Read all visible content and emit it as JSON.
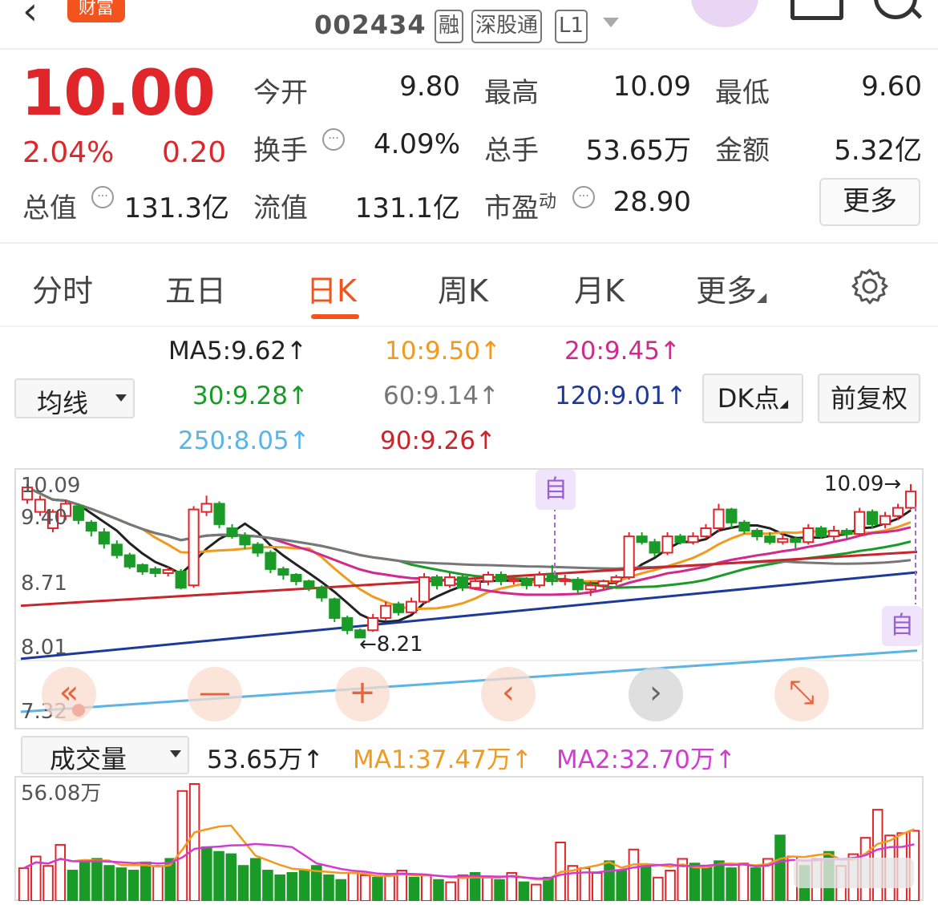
{
  "header": {
    "back_icon": "chevron-left-icon",
    "brand": "财富",
    "code": "002434",
    "tags": [
      "融",
      "深股通",
      "L1"
    ]
  },
  "quote": {
    "price": "10.00",
    "change_pct": "2.04%",
    "change": "0.20",
    "items": [
      {
        "label": "今开",
        "value": "9.80"
      },
      {
        "label": "最高",
        "value": "10.09"
      },
      {
        "label": "最低",
        "value": "9.60"
      },
      {
        "label": "换手",
        "value": "4.09%"
      },
      {
        "label": "总手",
        "value": "53.65万"
      },
      {
        "label": "金额",
        "value": "5.32亿"
      },
      {
        "label": "总值",
        "value": "131.3亿"
      },
      {
        "label": "流值",
        "value": "131.1亿"
      },
      {
        "label": "市盈",
        "sup": "动",
        "value": "28.90"
      }
    ],
    "more_button": "更多"
  },
  "tabs": [
    "分时",
    "五日",
    "日K",
    "周K",
    "月K",
    "更多"
  ],
  "active_tab": 2,
  "ma_selector": "均线",
  "ma_legend": [
    {
      "text": "MA5:9.62↑",
      "color": "#222222"
    },
    {
      "text": "10:9.50↑",
      "color": "#f29a1d"
    },
    {
      "text": "20:9.45↑",
      "color": "#d2298f"
    },
    {
      "text": "30:9.28↑",
      "color": "#1a9a26"
    },
    {
      "text": "60:9.14↑",
      "color": "#777777"
    },
    {
      "text": "120:9.01↑",
      "color": "#1d3a9a"
    },
    {
      "text": "250:8.05↑",
      "color": "#5ab4e6"
    },
    {
      "text": "90:9.26↑",
      "color": "#c8262d"
    }
  ],
  "dk_button": "DK点",
  "adjust_button": "前复权",
  "chart_labels": {
    "top": "10.09",
    "upper": "9.40",
    "mid": "8.71",
    "lower": "8.01",
    "bottom": "7.32",
    "high_marker": "10.09→",
    "low_marker": "←8.21",
    "zi": "自"
  },
  "chart_controls": [
    "«",
    "—",
    "+",
    "‹",
    "›",
    "⤡"
  ],
  "volume_selector": "成交量",
  "volume_legend": [
    {
      "text": "53.65万↑",
      "color": "#222222"
    },
    {
      "text": "MA1:37.47万↑",
      "color": "#f29a1d"
    },
    {
      "text": "MA2:32.70万↑",
      "color": "#d43ad1"
    }
  ],
  "volume_max_label": "56.08万",
  "chart_data": {
    "type": "candlestick",
    "ylim": [
      7.32,
      10.09
    ],
    "candles": [
      [
        9.9,
        10.05,
        10.09,
        9.85
      ],
      [
        9.75,
        9.9,
        9.95,
        9.7
      ],
      [
        9.55,
        9.75,
        9.78,
        9.5
      ],
      [
        9.7,
        9.85,
        9.9,
        9.65
      ],
      [
        9.82,
        9.65,
        9.85,
        9.6
      ],
      [
        9.62,
        9.52,
        9.65,
        9.45
      ],
      [
        9.5,
        9.36,
        9.55,
        9.3
      ],
      [
        9.35,
        9.22,
        9.4,
        9.18
      ],
      [
        9.22,
        9.08,
        9.25,
        9.05
      ],
      [
        9.1,
        9.02,
        9.12,
        8.98
      ],
      [
        9.05,
        9.0,
        9.08,
        8.95
      ],
      [
        9.0,
        9.04,
        9.08,
        8.96
      ],
      [
        9.02,
        8.82,
        9.05,
        8.8
      ],
      [
        8.85,
        9.78,
        9.82,
        8.82
      ],
      [
        9.75,
        9.85,
        9.95,
        9.7
      ],
      [
        9.85,
        9.6,
        9.88,
        9.55
      ],
      [
        9.55,
        9.45,
        9.6,
        9.42
      ],
      [
        9.45,
        9.35,
        9.5,
        9.3
      ],
      [
        9.35,
        9.25,
        9.38,
        9.2
      ],
      [
        9.25,
        9.05,
        9.28,
        9.0
      ],
      [
        9.05,
        8.98,
        9.08,
        8.92
      ],
      [
        8.98,
        8.9,
        9.0,
        8.85
      ],
      [
        8.9,
        8.82,
        8.92,
        8.78
      ],
      [
        8.82,
        8.7,
        8.85,
        8.65
      ],
      [
        8.68,
        8.45,
        8.7,
        8.4
      ],
      [
        8.45,
        8.3,
        8.48,
        8.25
      ],
      [
        8.3,
        8.21,
        8.32,
        8.21
      ],
      [
        8.3,
        8.45,
        8.5,
        8.28
      ],
      [
        8.45,
        8.6,
        8.65,
        8.42
      ],
      [
        8.62,
        8.52,
        8.65,
        8.48
      ],
      [
        8.52,
        8.65,
        8.7,
        8.5
      ],
      [
        8.65,
        8.95,
        9.0,
        8.62
      ],
      [
        8.95,
        8.85,
        8.98,
        8.8
      ],
      [
        8.85,
        8.95,
        9.0,
        8.82
      ],
      [
        8.95,
        8.82,
        8.98,
        8.78
      ],
      [
        8.82,
        8.9,
        8.95,
        8.8
      ],
      [
        8.9,
        8.98,
        9.02,
        8.85
      ],
      [
        8.98,
        8.9,
        9.02,
        8.85
      ],
      [
        8.9,
        8.92,
        8.98,
        8.86
      ],
      [
        8.92,
        8.85,
        8.95,
        8.8
      ],
      [
        8.85,
        8.98,
        9.02,
        8.82
      ],
      [
        8.98,
        8.9,
        9.1,
        8.85
      ],
      [
        8.9,
        8.92,
        8.98,
        8.85
      ],
      [
        8.92,
        8.8,
        8.95,
        8.75
      ],
      [
        8.8,
        8.85,
        8.9,
        8.72
      ],
      [
        8.85,
        8.9,
        8.92,
        8.8
      ],
      [
        8.9,
        8.95,
        8.98,
        8.85
      ],
      [
        8.95,
        9.45,
        9.5,
        8.92
      ],
      [
        9.45,
        9.38,
        9.5,
        9.35
      ],
      [
        9.38,
        9.25,
        9.42,
        9.2
      ],
      [
        9.25,
        9.45,
        9.5,
        9.22
      ],
      [
        9.45,
        9.38,
        9.48,
        9.35
      ],
      [
        9.38,
        9.45,
        9.5,
        9.35
      ],
      [
        9.45,
        9.55,
        9.6,
        9.42
      ],
      [
        9.55,
        9.78,
        9.85,
        9.5
      ],
      [
        9.78,
        9.62,
        9.8,
        9.55
      ],
      [
        9.62,
        9.52,
        9.65,
        9.48
      ],
      [
        9.52,
        9.45,
        9.55,
        9.4
      ],
      [
        9.45,
        9.38,
        9.5,
        9.35
      ],
      [
        9.38,
        9.42,
        9.48,
        9.35
      ],
      [
        9.42,
        9.38,
        9.45,
        9.3
      ],
      [
        9.38,
        9.55,
        9.6,
        9.35
      ],
      [
        9.55,
        9.45,
        9.58,
        9.42
      ],
      [
        9.45,
        9.52,
        9.58,
        9.4
      ],
      [
        9.52,
        9.48,
        9.55,
        9.42
      ],
      [
        9.48,
        9.75,
        9.8,
        9.45
      ],
      [
        9.75,
        9.6,
        9.78,
        9.55
      ],
      [
        9.6,
        9.7,
        9.75,
        9.55
      ],
      [
        9.7,
        9.8,
        9.85,
        9.65
      ],
      [
        9.8,
        10.0,
        10.09,
        9.78
      ]
    ],
    "volumes": [
      0.28,
      0.38,
      0.3,
      0.48,
      0.26,
      0.33,
      0.36,
      0.3,
      0.28,
      0.26,
      0.33,
      0.3,
      0.36,
      0.94,
      1.0,
      0.46,
      0.42,
      0.4,
      0.3,
      0.36,
      0.26,
      0.22,
      0.24,
      0.26,
      0.3,
      0.22,
      0.18,
      0.24,
      0.22,
      0.2,
      0.22,
      0.26,
      0.2,
      0.22,
      0.18,
      0.16,
      0.22,
      0.24,
      0.2,
      0.18,
      0.24,
      0.16,
      0.14,
      0.2,
      0.5,
      0.3,
      0.28,
      0.24,
      0.34,
      0.26,
      0.44,
      0.3,
      0.2,
      0.26,
      0.36,
      0.32,
      0.3,
      0.34,
      0.28,
      0.32,
      0.28,
      0.36,
      0.56,
      0.38,
      0.3,
      0.36,
      0.42,
      0.3,
      0.4,
      0.54,
      0.78,
      0.56,
      0.58,
      0.6
    ]
  }
}
